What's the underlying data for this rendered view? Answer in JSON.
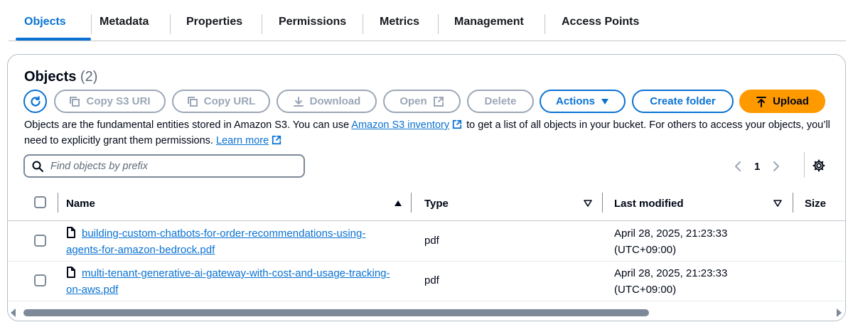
{
  "tabs": [
    "Objects",
    "Metadata",
    "Properties",
    "Permissions",
    "Metrics",
    "Management",
    "Access Points"
  ],
  "panel": {
    "title": "Objects",
    "count": "(2)",
    "toolbar": {
      "refresh_icon": "refresh-icon",
      "copy_s3_uri": "Copy S3 URI",
      "copy_url": "Copy URL",
      "download": "Download",
      "open": "Open",
      "delete": "Delete",
      "actions": "Actions",
      "create_folder": "Create folder",
      "upload": "Upload"
    },
    "description": {
      "part1": "Objects are the fundamental entities stored in Amazon S3. You can use ",
      "inventory_link": "Amazon S3 inventory",
      "part2": " to get a list of all objects in your bucket. For others to access your objects, you’ll need to explicitly grant them permissions. ",
      "learn_more": "Learn more"
    },
    "search": {
      "placeholder": "Find objects by prefix"
    },
    "pager": {
      "current_page": "1"
    }
  },
  "table": {
    "columns": [
      "Name",
      "Type",
      "Last modified",
      "Size"
    ],
    "rows": [
      {
        "name": "building-custom-chatbots-for-order-recommendations-using-agents-for-amazon-bedrock.pdf",
        "type": "pdf",
        "last_modified": "April 28, 2025, 21:23:33 (UTC+09:00)"
      },
      {
        "name": "multi-tenant-generative-ai-gateway-with-cost-and-usage-tracking-on-aws.pdf",
        "type": "pdf",
        "last_modified": "April 28, 2025, 21:23:33 (UTC+09:00)"
      }
    ]
  },
  "colors": {
    "accent": "#0972d3",
    "upload": "#ff9900",
    "disabled": "#9ba7b6",
    "text": "#000716"
  }
}
